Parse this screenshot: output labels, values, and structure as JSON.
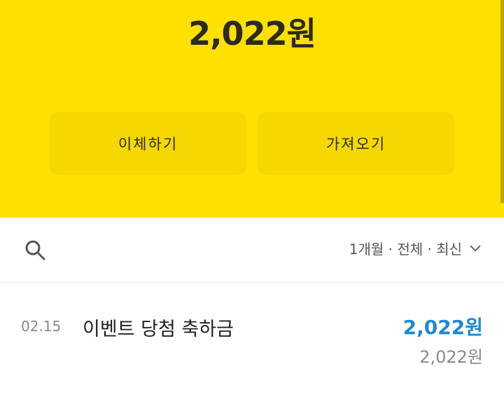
{
  "header": {
    "balance": "2,022원",
    "actions": [
      {
        "label": "이체하기",
        "icon": "none"
      },
      {
        "label": "가져오기",
        "icon": "none"
      }
    ]
  },
  "filter": {
    "search_icon": "search-icon",
    "label": "1개월 · 전체 · 최신",
    "chevron_icon": "chevron-down-icon"
  },
  "transactions": [
    {
      "date": "02.15",
      "title": "이벤트 당첨 축하금",
      "amount": "2,022원",
      "balance_after": "2,022원"
    }
  ],
  "colors": {
    "header_bg": "#ffe100",
    "button_bg": "#f5d800",
    "amount_blue": "#1e88d4"
  }
}
